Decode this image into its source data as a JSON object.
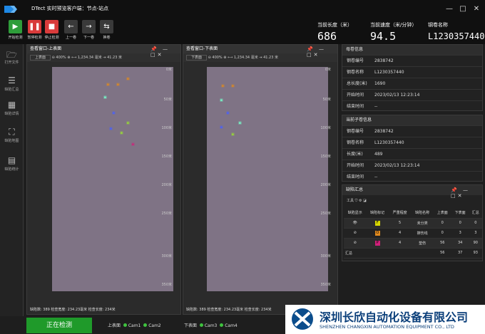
{
  "app": {
    "title": "DTect 实时预览客户端：节点-站点"
  },
  "toolbar": {
    "start": "开始检测",
    "pause": "暂停检测",
    "stop": "停止检测",
    "prev": "上一卷",
    "next": "下一卷",
    "swap": "换卷"
  },
  "readouts": {
    "length_label": "当前长度（米）",
    "length_value": "686",
    "speed_label": "当前速度（米/分钟）",
    "speed_value": "94.5",
    "coil_label": "钢卷名称",
    "coil_value": "L1230357440"
  },
  "nav": [
    {
      "icon": "folder-icon",
      "label": "打开文件"
    },
    {
      "icon": "list-icon",
      "label": "缺陷汇总"
    },
    {
      "icon": "grid-icon",
      "label": "缺陷详情"
    },
    {
      "icon": "map-icon",
      "label": "缺陷地图"
    },
    {
      "icon": "stats-icon",
      "label": "缺陷统计"
    }
  ],
  "viewer_upper": {
    "title": "查看窗口-上表面",
    "surface": "上表面",
    "zoom": "400%",
    "pos_value": "1,234.34",
    "pos_unit": "毫米",
    "width_value": "41.23",
    "width_unit": "米",
    "status": "缺陷数: 389    检查宽度: 234.23毫米    检查长度: 234米"
  },
  "viewer_lower": {
    "title": "查看窗口-下表面",
    "surface": "下表面",
    "zoom": "400%",
    "pos_value": "1,234.34",
    "pos_unit": "毫米",
    "width_value": "41.23",
    "width_unit": "米",
    "status": "缺陷数: 389    检查宽度: 234.23毫米    检查长度: 234米"
  },
  "ruler": [
    "0米",
    "50米",
    "100米",
    "150米",
    "200米",
    "250米",
    "300米",
    "350米"
  ],
  "mother_coil": {
    "header": "母卷信息",
    "rows": [
      {
        "k": "钢卷编号",
        "v": "2838742"
      },
      {
        "k": "钢卷名称",
        "v": "L1230357440"
      },
      {
        "k": "总长度(米)",
        "v": "1690"
      },
      {
        "k": "开始时间",
        "v": "2023/02/13 12:23:14"
      },
      {
        "k": "结束时间",
        "v": "--"
      }
    ]
  },
  "child_coil": {
    "header": "当前子卷信息",
    "rows": [
      {
        "k": "钢卷编号",
        "v": "2838742"
      },
      {
        "k": "钢卷名称",
        "v": "L1230357440"
      },
      {
        "k": "长度(米)",
        "v": "489"
      },
      {
        "k": "开始时间",
        "v": "2023/02/13 12:23:14"
      },
      {
        "k": "结束时间",
        "v": "--"
      }
    ]
  },
  "defect_summary": {
    "header": "缺陷汇总",
    "tools_label": "工具",
    "columns": [
      "缺陷显示",
      "缺陷标记",
      "严重程度",
      "缺陷名称",
      "上表面",
      "下表面",
      "汇总"
    ],
    "rows": [
      {
        "mark_color": "#d8d800",
        "mark": "F",
        "severity": "5",
        "name": "未分类",
        "up": "0",
        "down": "0",
        "total": "0"
      },
      {
        "mark_color": "#e08a1e",
        "mark": "O",
        "severity": "4",
        "name": "擦伤线",
        "up": "0",
        "down": "3",
        "total": "3"
      },
      {
        "mark_color": "#d0207a",
        "mark": "P",
        "severity": "4",
        "name": "垫伤",
        "up": "56",
        "down": "34",
        "total": "90"
      }
    ],
    "total_label": "汇总",
    "total_up": "56",
    "total_down": "37",
    "total": "93"
  },
  "bottom": {
    "status_button": "正在检测",
    "upper_label": "上表面",
    "cam1": "Cam1",
    "cam2": "Cam2",
    "lower_label": "下表面",
    "cam3": "Cam3",
    "cam4": "Cam4"
  },
  "brand": {
    "cn": "深圳长欣自动化设备有限公司",
    "en": "SHENZHEN CHANGXIN AUTOMATION EQUIPMENT CO., LTD"
  }
}
